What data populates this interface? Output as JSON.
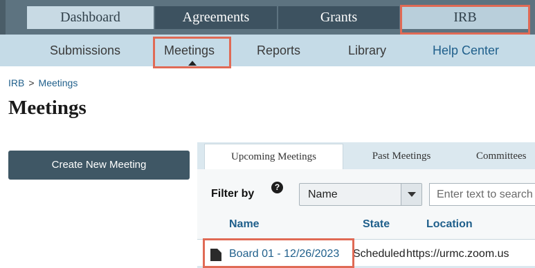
{
  "topnav": {
    "tabs": [
      {
        "label": "Dashboard"
      },
      {
        "label": "Agreements"
      },
      {
        "label": "Grants"
      },
      {
        "label": "IRB"
      }
    ]
  },
  "subnav": {
    "items": [
      {
        "label": "Submissions"
      },
      {
        "label": "Meetings"
      },
      {
        "label": "Reports"
      },
      {
        "label": "Library"
      },
      {
        "label": "Help Center"
      }
    ]
  },
  "breadcrumb": {
    "root": "IRB",
    "separator": ">",
    "current": "Meetings"
  },
  "page": {
    "title": "Meetings"
  },
  "actions": {
    "create_label": "Create New Meeting"
  },
  "panel": {
    "tabs": [
      {
        "label": "Upcoming Meetings"
      },
      {
        "label": "Past Meetings"
      },
      {
        "label": "Committees"
      }
    ],
    "filter": {
      "label": "Filter by",
      "help_icon": "question-circle-icon",
      "selected": "Name",
      "search_placeholder": "Enter text to search"
    },
    "columns": [
      "Name",
      "State",
      "Location"
    ],
    "rows": [
      {
        "icon": "document-icon",
        "name": "Board 01 - 12/26/2023",
        "state": "Scheduled",
        "location": "https://urmc.zoom.us"
      }
    ]
  },
  "colors": {
    "topnav_bg": "#5d7380",
    "tab_dark": "#3d5260",
    "subnav_bg": "#c5dbe7",
    "link": "#1f5f8b",
    "highlight": "#e06a55",
    "button_bg": "#3f5765"
  }
}
